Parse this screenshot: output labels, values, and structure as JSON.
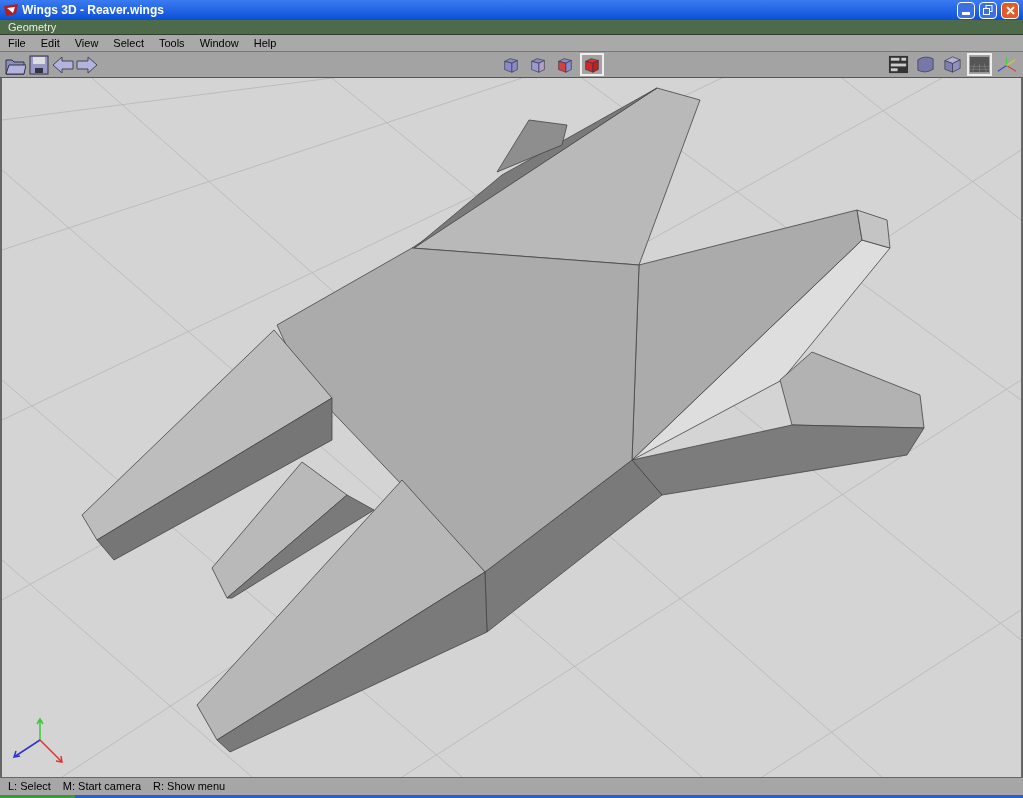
{
  "window": {
    "title": "Wings 3D - Reaver.wings"
  },
  "geometry_bar": {
    "title": "Geometry"
  },
  "menu": [
    "File",
    "Edit",
    "View",
    "Select",
    "Tools",
    "Window",
    "Help"
  ],
  "file_tools": [
    {
      "kind": "open"
    },
    {
      "kind": "save"
    },
    {
      "kind": "undo"
    },
    {
      "kind": "redo"
    }
  ],
  "select_modes": [
    {
      "kind": "vertex",
      "selected": false
    },
    {
      "kind": "edge",
      "selected": false
    },
    {
      "kind": "face",
      "selected": false
    },
    {
      "kind": "body",
      "selected": true
    }
  ],
  "view_tools": [
    {
      "kind": "outliner",
      "selected": false
    },
    {
      "kind": "smooth",
      "selected": false
    },
    {
      "kind": "flat",
      "selected": false
    },
    {
      "kind": "groundplane",
      "selected": true
    },
    {
      "kind": "axes",
      "selected": false
    }
  ],
  "status_bar": [
    "L: Select",
    "M: Start camera",
    "R: Show menu"
  ]
}
